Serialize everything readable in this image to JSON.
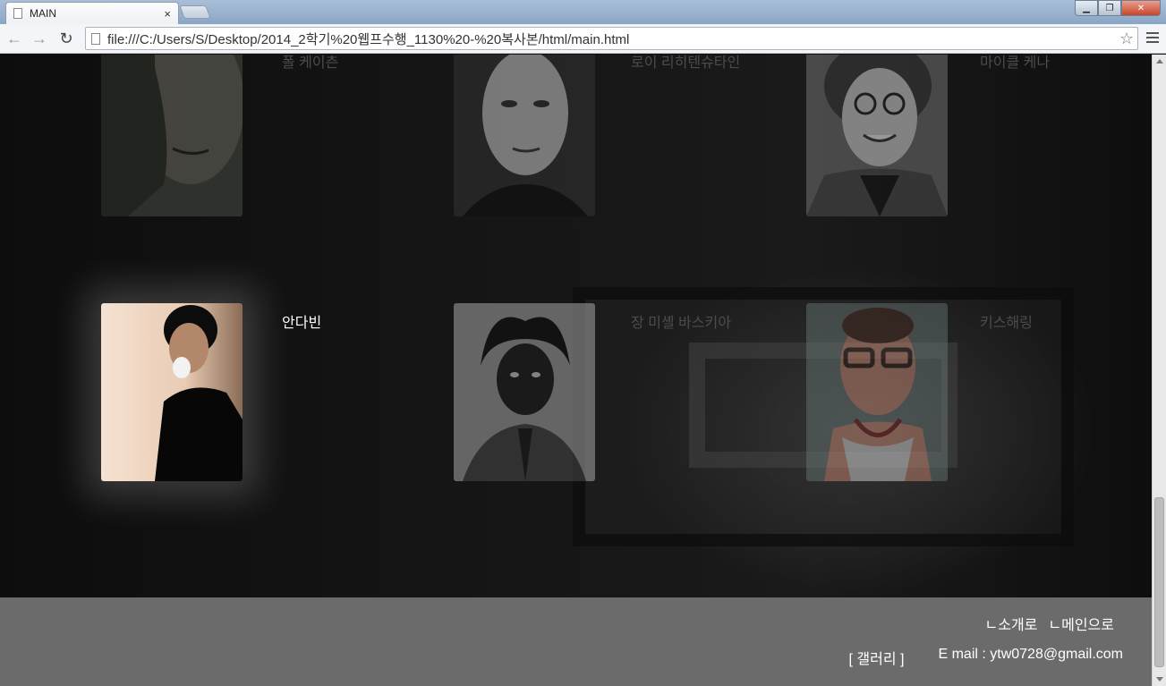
{
  "browser": {
    "tab_title": "MAIN",
    "tab_close": "×",
    "url": "file:///C:/Users/S/Desktop/2014_2학기%20웹프수행_1130%20-%20복사본/html/main.html",
    "back": "←",
    "forward": "→",
    "reload": "↻",
    "star": "☆",
    "min": "▁",
    "max": "❐",
    "close": "✕"
  },
  "gallery": {
    "row1": [
      {
        "name": "폴 케이츤"
      },
      {
        "name": "로이 리히텐슈타인"
      },
      {
        "name": "마이클 케나"
      }
    ],
    "row2": [
      {
        "name": "안다빈"
      },
      {
        "name": "장 미셸 바스키아"
      },
      {
        "name": "키스해링"
      }
    ]
  },
  "footer": {
    "link_intro": "ㄴ소개로",
    "link_main": "ㄴ메인으로",
    "gallery_label": "[ 갤러리 ]",
    "email": "E mail : ytw0728@gmail.com"
  }
}
